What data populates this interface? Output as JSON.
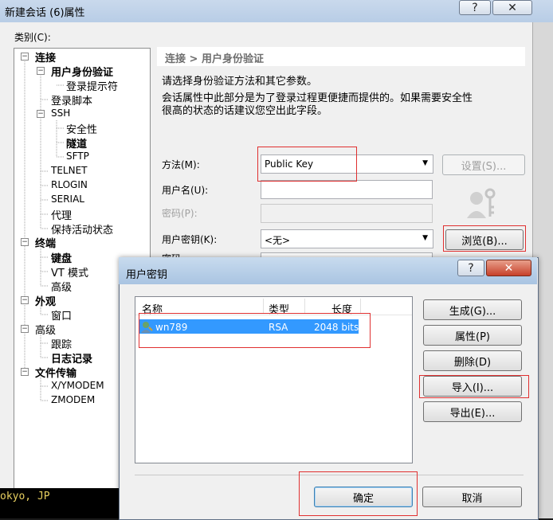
{
  "main_window": {
    "title": "新建会话 (6)属性",
    "help_glyph": "?",
    "close_glyph": "✕",
    "category_label": "类别(C):"
  },
  "tree": [
    {
      "label": "连接",
      "bold": true,
      "expander": "−"
    },
    {
      "label": "用户身份验证",
      "bold": true,
      "expander": "−"
    },
    {
      "label": "登录提示符",
      "bold": false,
      "expander": ""
    },
    {
      "label": "登录脚本",
      "bold": false,
      "expander": ""
    },
    {
      "label": "SSH",
      "bold": false,
      "expander": "−"
    },
    {
      "label": "安全性",
      "bold": false,
      "expander": ""
    },
    {
      "label": "隧道",
      "bold": true,
      "expander": ""
    },
    {
      "label": "SFTP",
      "bold": false,
      "expander": ""
    },
    {
      "label": "TELNET",
      "bold": false,
      "expander": ""
    },
    {
      "label": "RLOGIN",
      "bold": false,
      "expander": ""
    },
    {
      "label": "SERIAL",
      "bold": false,
      "expander": ""
    },
    {
      "label": "代理",
      "bold": false,
      "expander": ""
    },
    {
      "label": "保持活动状态",
      "bold": false,
      "expander": ""
    },
    {
      "label": "终端",
      "bold": true,
      "expander": "−"
    },
    {
      "label": "键盘",
      "bold": true,
      "expander": ""
    },
    {
      "label": "VT 模式",
      "bold": false,
      "expander": ""
    },
    {
      "label": "高级",
      "bold": false,
      "expander": ""
    },
    {
      "label": "外观",
      "bold": true,
      "expander": "−"
    },
    {
      "label": "窗口",
      "bold": false,
      "expander": ""
    },
    {
      "label": "高级",
      "bold": false,
      "expander": "−"
    },
    {
      "label": "跟踪",
      "bold": false,
      "expander": ""
    },
    {
      "label": "日志记录",
      "bold": true,
      "expander": ""
    },
    {
      "label": "文件传输",
      "bold": true,
      "expander": "−"
    },
    {
      "label": "X/YMODEM",
      "bold": false,
      "expander": ""
    },
    {
      "label": "ZMODEM",
      "bold": false,
      "expander": ""
    }
  ],
  "terminal_text": "okyo, JP",
  "auth_panel": {
    "header": "连接 > 用户身份验证",
    "desc1": "请选择身份验证方法和其它参数。",
    "desc2": "会话属性中此部分是为了登录过程更便捷而提供的。如果需要安全性",
    "desc3": "很高的状态的话建议您空出此字段。",
    "method_label": "方法(M):",
    "method_value": "Public Key",
    "settings_button": "设置(S)...",
    "username_label": "用户名(U):",
    "username_value": "",
    "password_label": "密码(P):",
    "userkey_label": "用户密钥(K):",
    "userkey_value": "<无>",
    "browse_button": "浏览(B)...",
    "passphrase_label_partial": "密码"
  },
  "key_dialog": {
    "title": "用户密钥",
    "help_glyph": "?",
    "close_glyph": "✕",
    "columns": {
      "name": "名称",
      "type": "类型",
      "length": "长度"
    },
    "rows": [
      {
        "name": "wn789",
        "type": "RSA",
        "length": "2048 bits"
      }
    ],
    "buttons": {
      "generate": "生成(G)...",
      "properties": "属性(P)",
      "delete": "删除(D)",
      "import": "导入(I)...",
      "export": "导出(E)...",
      "ok": "确定",
      "cancel": "取消"
    }
  },
  "colors": {
    "highlight_red": "#e03030",
    "selection_blue": "#3399ff",
    "terminal_text": "#e8d060"
  }
}
